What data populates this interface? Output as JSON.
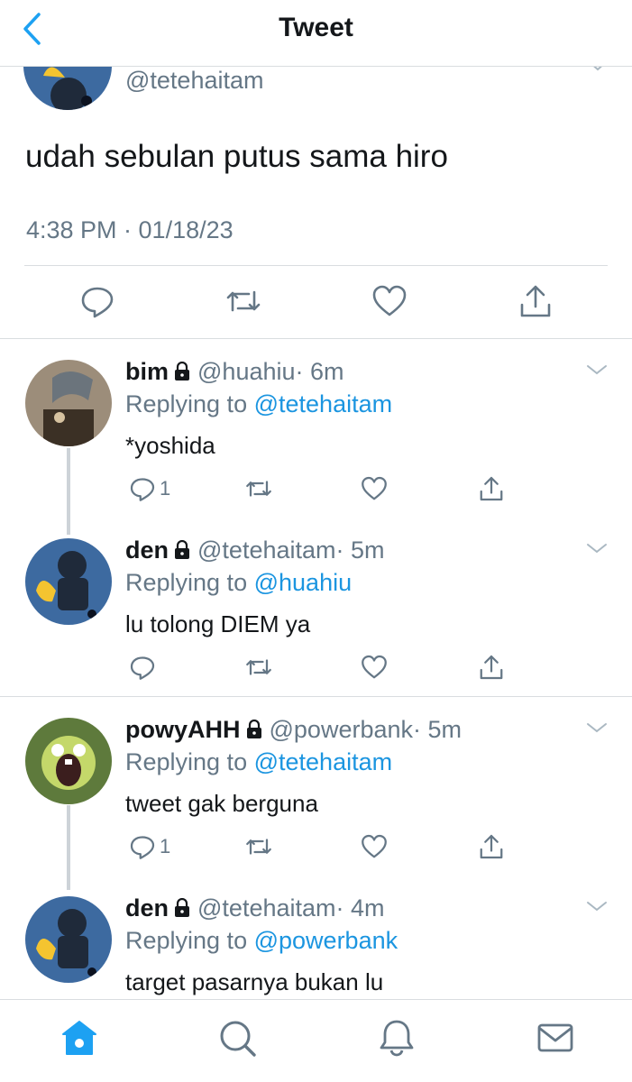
{
  "header": {
    "title": "Tweet",
    "back_icon": "chevron-left-icon"
  },
  "main_tweet": {
    "handle": "@tetehaitam",
    "text": "udah sebulan putus sama hiro",
    "timestamp": "4:38 PM · 01/18/23",
    "actions": [
      "reply-icon",
      "retweet-icon",
      "like-icon",
      "share-icon"
    ]
  },
  "replies": [
    {
      "name": "bim",
      "handle": "@huahiu",
      "time": "· 6m",
      "replying_prefix": "Replying to",
      "replying_to": "@tetehaitam",
      "text": "*yoshida",
      "reply_count": "1"
    },
    {
      "name": "den",
      "handle": "@tetehaitam",
      "time": "· 5m",
      "replying_prefix": "Replying to",
      "replying_to": "@huahiu",
      "text": "lu tolong DIEM ya",
      "reply_count": ""
    },
    {
      "name": "powyAHH",
      "handle": "@powerbank",
      "time": "· 5m",
      "replying_prefix": "Replying to",
      "replying_to": "@tetehaitam",
      "text": "tweet gak berguna",
      "reply_count": "1"
    },
    {
      "name": "den",
      "handle": "@tetehaitam",
      "time": "· 4m",
      "replying_prefix": "Replying to",
      "replying_to": "@powerbank",
      "text": "target pasarnya bukan lu",
      "reply_count": ""
    }
  ],
  "tabbar": [
    "home-icon",
    "search-icon",
    "notifications-icon",
    "messages-icon"
  ],
  "colors": {
    "accent": "#1da1f2",
    "mention": "#1b95e0",
    "muted": "#657786",
    "divider": "#d9dde0"
  }
}
